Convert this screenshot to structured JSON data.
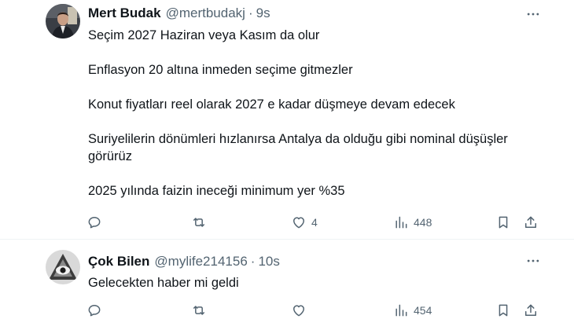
{
  "tweets": [
    {
      "name": "Mert Budak",
      "handle": "@mertbudakj",
      "separator": "·",
      "time": "9s",
      "paragraphs": [
        "Seçim 2027 Haziran veya Kasım da olur",
        "Enflasyon 20 altına inmeden seçime gitmezler",
        "Konut fiyatları reel olarak 2027 e kadar düşmeye devam edecek",
        "Suriyelilerin dönümleri hızlanırsa Antalya da olduğu gibi nominal düşüşler görürüz",
        "2025 yılında faizin ineceği minimum yer %35"
      ],
      "likes": "4",
      "views": "448"
    },
    {
      "name": "Çok Bilen",
      "handle": "@mylife214156",
      "separator": "·",
      "time": "10s",
      "paragraphs": [
        "Gelecekten haber mi geldi"
      ],
      "likes": "",
      "views": "454"
    }
  ],
  "icons": {
    "reply": "reply-icon",
    "retweet": "retweet-icon",
    "like": "heart-icon",
    "views": "views-chart-icon",
    "bookmark": "bookmark-icon",
    "share": "share-icon",
    "more": "more-dots-icon"
  },
  "colors": {
    "text_primary": "#0f1419",
    "text_secondary": "#536471",
    "divider": "#eff3f4"
  }
}
